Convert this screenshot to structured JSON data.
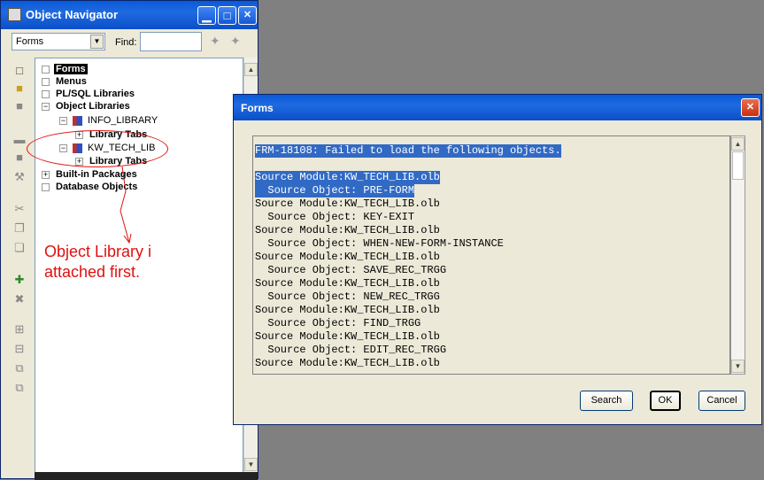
{
  "navigator": {
    "title": "Object Navigator",
    "minimize": "▁",
    "maximize": "□",
    "close": "✕",
    "type_select": "Forms",
    "find_label": "Find:",
    "find_value": "",
    "tree": [
      {
        "label": "Forms",
        "expander": "",
        "selected": true
      },
      {
        "label": "Menus",
        "expander": ""
      },
      {
        "label": "PL/SQL Libraries",
        "expander": ""
      },
      {
        "label": "Object Libraries",
        "expander": "−"
      },
      {
        "label": "INFO_LIBRARY",
        "expander": "−"
      },
      {
        "label": "Library Tabs",
        "expander": "+"
      },
      {
        "label": "KW_TECH_LIB",
        "expander": "−"
      },
      {
        "label": "Library Tabs",
        "expander": "+"
      },
      {
        "label": "Built-in Packages",
        "expander": "+"
      },
      {
        "label": "Database Objects",
        "expander": ""
      }
    ]
  },
  "annotation": {
    "text": "Object Library i\nattached first.",
    "color": "#e01010"
  },
  "dialog": {
    "title": "Forms",
    "close": "✕",
    "lines": [
      "FRM-18108: Failed to load the following objects.",
      "",
      "Source Module:KW_TECH_LIB.olb",
      "  Source Object: PRE-FORM",
      "Source Module:KW_TECH_LIB.olb",
      "  Source Object: KEY-EXIT",
      "Source Module:KW_TECH_LIB.olb",
      "  Source Object: WHEN-NEW-FORM-INSTANCE",
      "Source Module:KW_TECH_LIB.olb",
      "  Source Object: SAVE_REC_TRGG",
      "Source Module:KW_TECH_LIB.olb",
      "  Source Object: NEW_REC_TRGG",
      "Source Module:KW_TECH_LIB.olb",
      "  Source Object: FIND_TRGG",
      "Source Module:KW_TECH_LIB.olb",
      "  Source Object: EDIT_REC_TRGG",
      "Source Module:KW_TECH_LIB.olb"
    ],
    "buttons": {
      "search": "Search",
      "ok": "OK",
      "cancel": "Cancel"
    }
  }
}
